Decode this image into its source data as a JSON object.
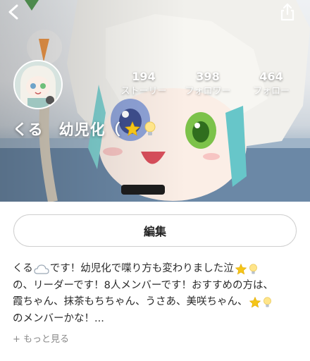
{
  "header": {
    "back_icon": "chevron-left-icon",
    "share_icon": "share-icon"
  },
  "profile": {
    "name": "くる　幼児化（",
    "name_icons": [
      "star-emoji-icon",
      "lightbulb-emoji-icon"
    ],
    "stats": [
      {
        "value": "194",
        "label": "ストーリー"
      },
      {
        "value": "398",
        "label": "フォロワー"
      },
      {
        "value": "464",
        "label": "フォロー"
      }
    ]
  },
  "edit_button": {
    "label": "編集"
  },
  "bio": {
    "line1_a": "くる",
    "line1_b": "です！幼児化で喋り方も変わりました泣",
    "line2": "の、リーダーです！8人メンバーです！おすすめの方は、",
    "line3": "霞ちゃん、抹茶もちちゃん、うさあ、美咲ちゃん、",
    "line4": "のメンバーかな！...",
    "icons": [
      "cloud-emoji-icon",
      "star-emoji-icon",
      "lightbulb-emoji-icon"
    ]
  },
  "more_link": {
    "label": "+ もっと見る"
  },
  "colors": {
    "star": "#f5c518",
    "bulb": "#ffe58a",
    "text": "#2a2a2a",
    "muted": "#8a8a8a"
  }
}
